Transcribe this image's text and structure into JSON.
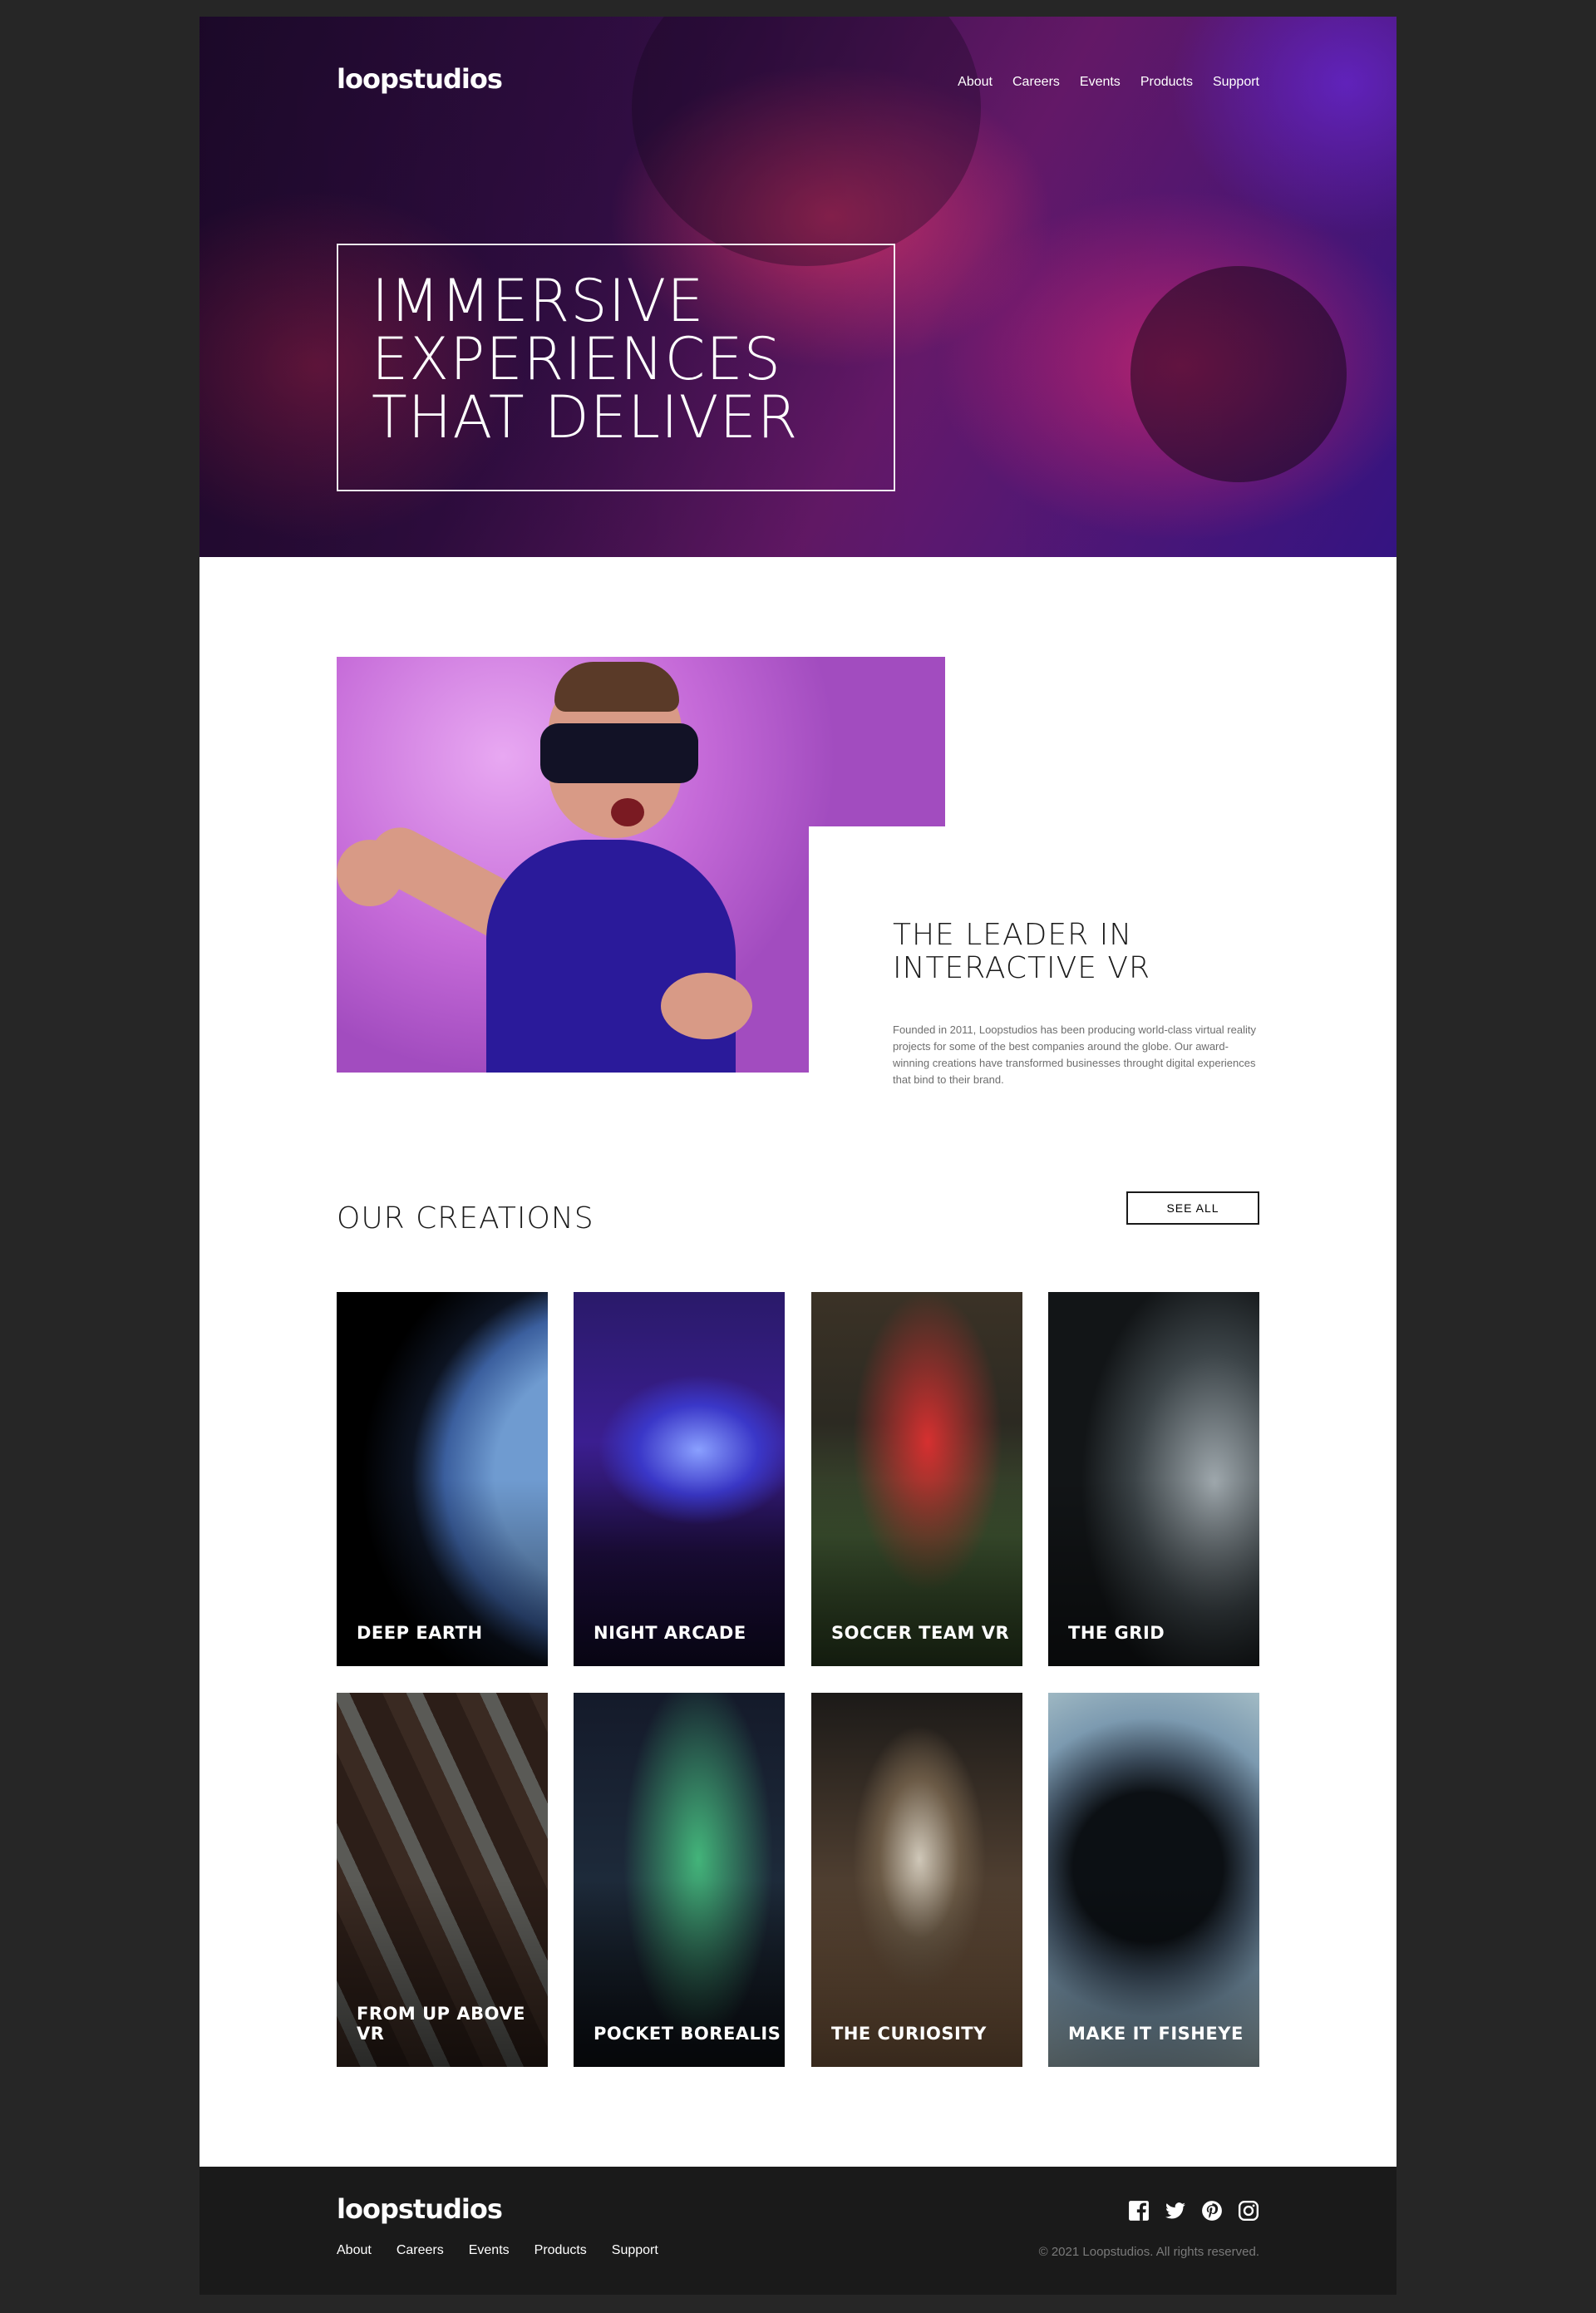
{
  "brand": {
    "logo": "loopstudios"
  },
  "nav": {
    "items": [
      "About",
      "Careers",
      "Events",
      "Products",
      "Support"
    ]
  },
  "hero": {
    "line1": "IMMERSIVE",
    "line2": "EXPERIENCES",
    "line3": "THAT DELIVER"
  },
  "leader": {
    "line1": "THE LEADER IN",
    "line2": "INTERACTIVE VR",
    "body": "Founded in 2011, Loopstudios has been producing world-class virtual reality projects for some of the best companies around the globe. Our award-winning creations have transformed businesses throught digital experiences that bind to their brand."
  },
  "creations": {
    "title": "OUR CREATIONS",
    "see_all": "SEE ALL",
    "cards": [
      {
        "label": "DEEP EARTH"
      },
      {
        "label": "NIGHT ARCADE"
      },
      {
        "label": "SOCCER TEAM VR"
      },
      {
        "label": "THE GRID"
      },
      {
        "label": "FROM UP ABOVE VR"
      },
      {
        "label": "POCKET BOREALIS"
      },
      {
        "label": "THE CURIOSITY"
      },
      {
        "label": "MAKE IT FISHEYE"
      }
    ]
  },
  "footer": {
    "logo": "loopstudios",
    "nav": [
      "About",
      "Careers",
      "Events",
      "Products",
      "Support"
    ],
    "social": [
      "facebook-icon",
      "twitter-icon",
      "pinterest-icon",
      "instagram-icon"
    ],
    "copyright": "© 2021 Loopstudios. All rights reserved."
  }
}
